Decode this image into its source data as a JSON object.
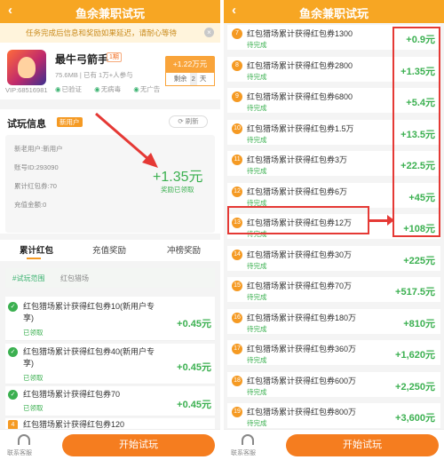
{
  "topbar": {
    "back_icon": "chevron-left-icon",
    "title": "鱼余兼职试玩"
  },
  "notice": {
    "text": "任务完成后信息和奖励如果延迟，请耐心等待",
    "close_glyph": "×"
  },
  "app": {
    "name": "最牛弓箭手",
    "period_tag": "1期",
    "vip": "VIP:68516981",
    "meta": "75.6MB | 已有 1万+人参与",
    "badges": [
      "已验证",
      "无病毒",
      "无广告"
    ],
    "reward": "+1.22万元",
    "remain_label": "剩余",
    "remain_value": "2",
    "remain_unit": "天"
  },
  "info": {
    "title": "试玩信息",
    "new_user_tag": "新用户",
    "refresh_label": "刷新",
    "lines": [
      "新老用户:新用户",
      "账号ID:293090",
      "累计红包券:70",
      "充值金额:0"
    ],
    "big_amount": "+1.35元",
    "claimed_label": "奖励已领取"
  },
  "tabs": [
    "累计红包",
    "充值奖励",
    "冲榜奖励"
  ],
  "filter": {
    "scope": "#试玩范围",
    "game": "红包猎场"
  },
  "left_list": [
    {
      "name": "红包猎场累计获得红包券10(新用户专享)",
      "status": "已领取",
      "amount": "+0.45元"
    },
    {
      "name": "红包猎场累计获得红包券40(新用户专享)",
      "status": "已领取",
      "amount": "+0.45元"
    },
    {
      "name": "红包猎场累计获得红包券70",
      "status": "已领取",
      "amount": "+0.45元"
    },
    {
      "num": "4",
      "name": "红包猎场累计获得红包券120",
      "status": "",
      "amount": ""
    }
  ],
  "bottom": {
    "service_label": "联系客服",
    "start_label": "开始试玩"
  },
  "right_list": [
    {
      "num": "7",
      "name": "红包猎场累计获得红包券1300",
      "status": "待完成",
      "amount": "+0.9元"
    },
    {
      "num": "8",
      "name": "红包猎场累计获得红包券2800",
      "status": "待完成",
      "amount": "+1.35元"
    },
    {
      "num": "9",
      "name": "红包猎场累计获得红包券6800",
      "status": "待完成",
      "amount": "+5.4元"
    },
    {
      "num": "10",
      "name": "红包猎场累计获得红包券1.5万",
      "status": "待完成",
      "amount": "+13.5元"
    },
    {
      "num": "11",
      "name": "红包猎场累计获得红包券3万",
      "status": "待完成",
      "amount": "+22.5元"
    },
    {
      "num": "12",
      "name": "红包猎场累计获得红包券6万",
      "status": "待完成",
      "amount": "+45元"
    },
    {
      "num": "13",
      "name": "红包猎场累计获得红包券12万",
      "status": "待完成",
      "amount": "+108元"
    },
    {
      "num": "14",
      "name": "红包猎场累计获得红包券30万",
      "status": "待完成",
      "amount": "+225元"
    },
    {
      "num": "15",
      "name": "红包猎场累计获得红包券70万",
      "status": "待完成",
      "amount": "+517.5元"
    },
    {
      "num": "16",
      "name": "红包猎场累计获得红包券180万",
      "status": "待完成",
      "amount": "+810元"
    },
    {
      "num": "17",
      "name": "红包猎场累计获得红包券360万",
      "status": "待完成",
      "amount": "+1,620元"
    },
    {
      "num": "18",
      "name": "红包猎场累计获得红包券600万",
      "status": "待完成",
      "amount": "+2,250元"
    },
    {
      "num": "19",
      "name": "红包猎场累计获得红包券800万",
      "status": "待完成",
      "amount": "+3,600元"
    }
  ],
  "colors": {
    "brand": "#f7a623",
    "button": "#f57d1f",
    "success": "#3bb050",
    "annotation": "#e53935"
  }
}
